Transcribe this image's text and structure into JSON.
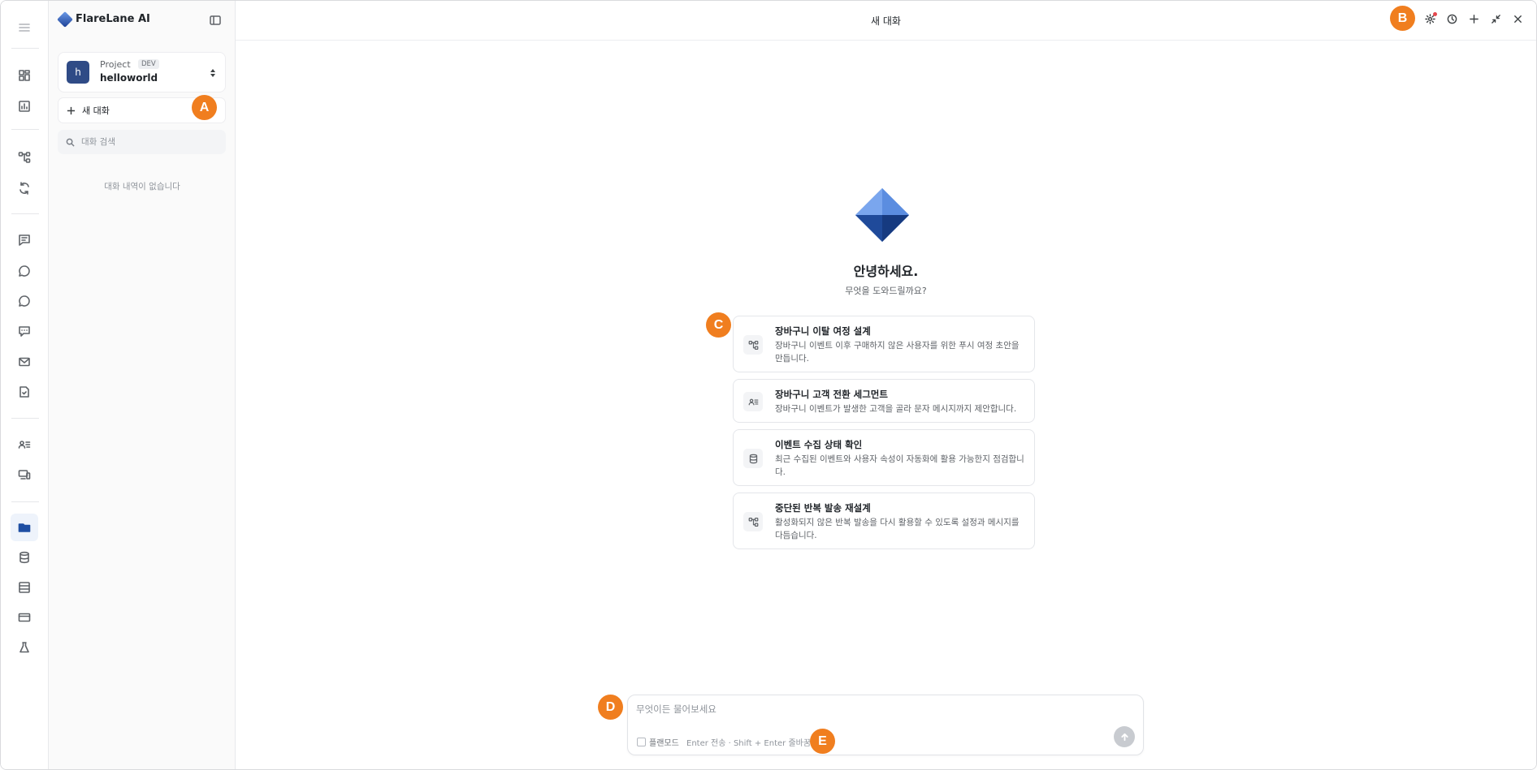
{
  "rail": {
    "items": [
      {
        "icon": "dashboard-icon"
      },
      {
        "icon": "analytics-icon"
      },
      {
        "icon": "journey-icon"
      },
      {
        "icon": "sync-icon"
      },
      {
        "icon": "message-icon"
      },
      {
        "icon": "chat-icon"
      },
      {
        "icon": "chat-bubble-icon"
      },
      {
        "icon": "inapp-message-icon"
      },
      {
        "icon": "mail-icon"
      },
      {
        "icon": "document-icon"
      },
      {
        "icon": "users-list-icon"
      },
      {
        "icon": "devices-icon"
      },
      {
        "icon": "folder-icon",
        "active": true
      },
      {
        "icon": "database-icon"
      },
      {
        "icon": "table-icon"
      },
      {
        "icon": "billing-card-icon"
      },
      {
        "icon": "lab-flask-icon"
      }
    ]
  },
  "sidebar": {
    "brand_title": "FlareLane AI",
    "project": {
      "avatar_letter": "h",
      "label": "Project",
      "badge": "DEV",
      "name": "helloworld"
    },
    "new_chat_label": "새 대화",
    "search_placeholder": "대화 검색",
    "empty_history": "대화 내역이 없습니다"
  },
  "topbar": {
    "title": "새 대화"
  },
  "main": {
    "greeting": "안녕하세요.",
    "subgreeting": "무엇을 도와드릴까요?",
    "suggestions": [
      {
        "icon": "journey-icon",
        "title": "장바구니 이탈 여정 설계",
        "description": "장바구니 이벤트 이후 구매하지 않은 사용자를 위한 푸시 여정 초안을 만듭니다."
      },
      {
        "icon": "users-list-icon",
        "title": "장바구니 고객 전환 세그먼트",
        "description": "장바구니 이벤트가 발생한 고객을 골라 문자 메시지까지 제안합니다."
      },
      {
        "icon": "database-icon",
        "title": "이벤트 수집 상태 확인",
        "description": "최근 수집된 이벤트와 사용자 속성이 자동화에 활용 가능한지 점검합니다."
      },
      {
        "icon": "journey-icon",
        "title": "중단된 반복 발송 재설계",
        "description": "활성화되지 않은 반복 발송을 다시 활용할 수 있도록 설정과 메시지를 다듬습니다."
      }
    ]
  },
  "composer": {
    "placeholder": "무엇이든 물어보세요",
    "plan_mode_label": "플랜모드",
    "hint": "Enter 전송 · Shift + Enter 줄바꿈"
  },
  "markers": {
    "a": "A",
    "b": "B",
    "c": "C",
    "d": "D",
    "e": "E"
  },
  "colors": {
    "marker": "#f07e1f",
    "brand": "#2f4b86",
    "active_rail": "#eef3fb"
  }
}
